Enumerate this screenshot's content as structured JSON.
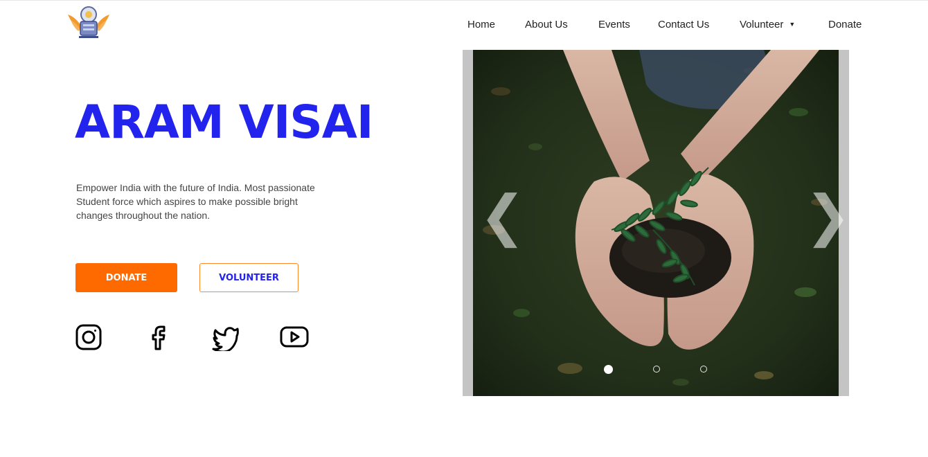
{
  "header": {
    "logo_icon": "aram-visai-emblem-logo",
    "nav": [
      {
        "label": "Home"
      },
      {
        "label": "About Us"
      },
      {
        "label": "Events"
      },
      {
        "label": "Contact Us"
      },
      {
        "label": "Volunteer",
        "has_dropdown": true
      },
      {
        "label": "Donate"
      }
    ]
  },
  "hero": {
    "title": "ARAM VISAI",
    "description": "Empower India with the future of India. Most passionate Student force which aspires to make possible bright changes throughout the nation.",
    "donate_label": "DONATE",
    "volunteer_label": "VOLUNTEER",
    "social": [
      "instagram-icon",
      "facebook-icon",
      "twitter-icon",
      "youtube-icon"
    ]
  },
  "carousel": {
    "slide_image": "hands-holding-soil-with-plant-photo",
    "prev_glyph": "❮",
    "next_glyph": "❯",
    "active_index": 0,
    "slide_count": 3
  },
  "colors": {
    "brand_blue": "#2323ee",
    "accent_orange": "#ff6a00"
  }
}
